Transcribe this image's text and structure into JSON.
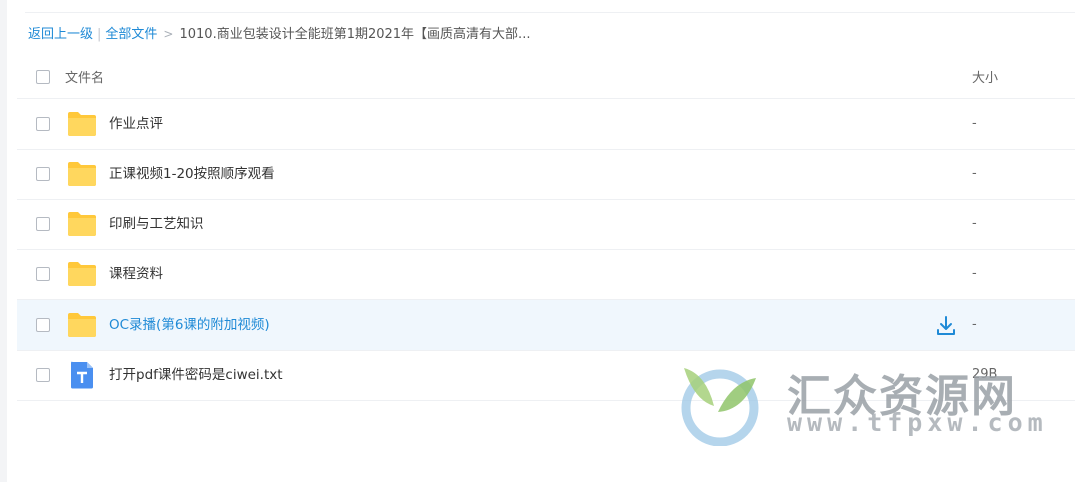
{
  "breadcrumb": {
    "back": "返回上一级",
    "separator": "|",
    "all_files": "全部文件",
    "arrow": ">",
    "current": "1010.商业包装设计全能班第1期2021年【画质高清有大部..."
  },
  "header": {
    "name_col": "文件名",
    "size_col": "大小"
  },
  "rows": [
    {
      "name": "作业点评",
      "size": "-",
      "icon": "folder-icon"
    },
    {
      "name": "正课视频1-20按照顺序观看",
      "size": "-",
      "icon": "folder-icon"
    },
    {
      "name": "印刷与工艺知识",
      "size": "-",
      "icon": "folder-icon"
    },
    {
      "name": "课程资料",
      "size": "-",
      "icon": "folder-icon"
    },
    {
      "name": "OC录播(第6课的附加视频)",
      "size": "-",
      "icon": "folder-icon"
    },
    {
      "name": "打开pdf课件密码是ciwei.txt",
      "size": "29B",
      "icon": "text-file-icon"
    }
  ],
  "watermark": {
    "title": "汇众资源网",
    "url": "www.tfpxw.com"
  },
  "colors": {
    "link": "#1f8ad6",
    "folder": "#ffd04b",
    "file": "#4a8ff0",
    "hover_row": "#f0f7fd"
  }
}
